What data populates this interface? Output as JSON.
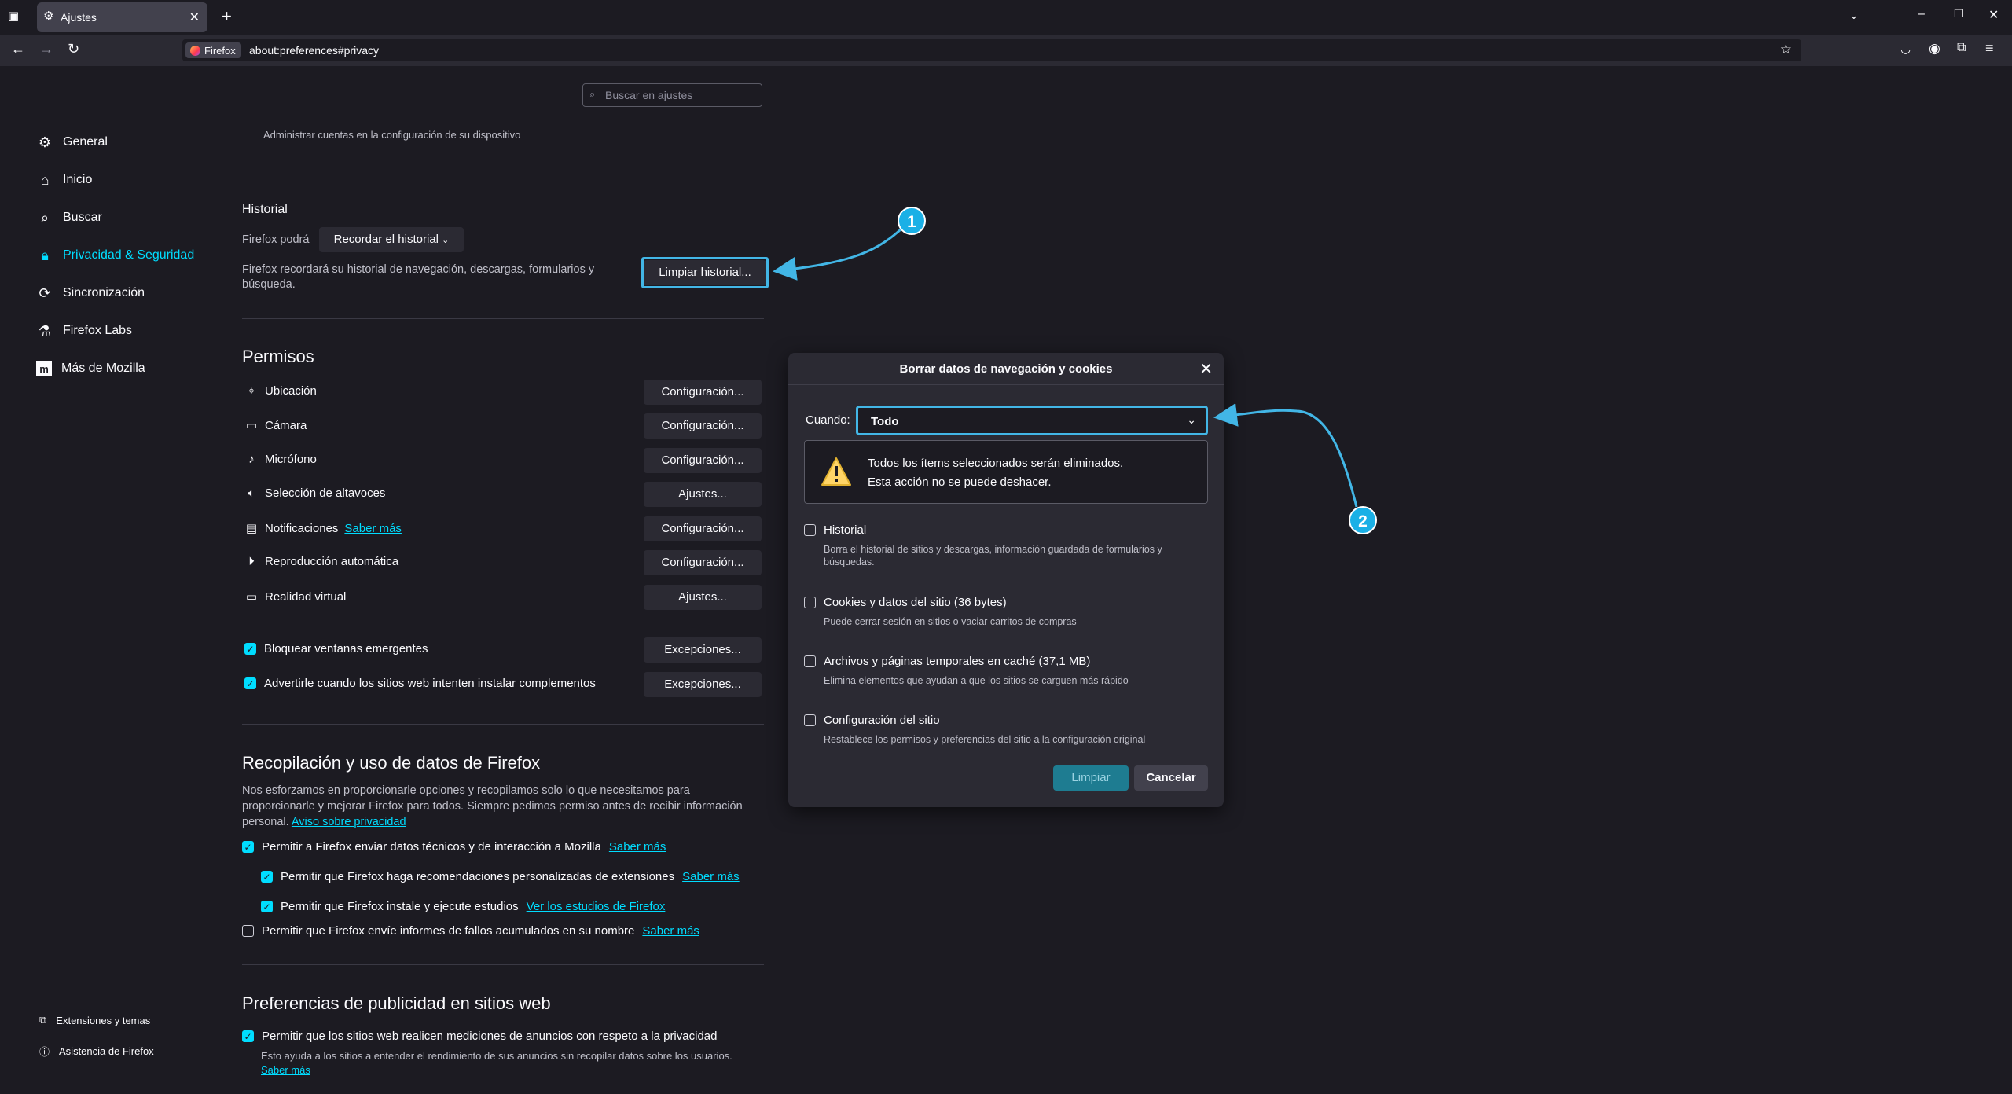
{
  "browser": {
    "tab_title": "Ajustes",
    "url_chip": "Firefox",
    "url": "about:preferences#privacy",
    "new_tab": "+",
    "tab_close": "✕"
  },
  "search": {
    "placeholder": "Buscar en ajustes"
  },
  "sidebar": {
    "items": [
      {
        "label": "General"
      },
      {
        "label": "Inicio"
      },
      {
        "label": "Buscar"
      },
      {
        "label": "Privacidad & Seguridad"
      },
      {
        "label": "Sincronización"
      },
      {
        "label": "Firefox Labs"
      },
      {
        "label": "Más de Mozilla"
      }
    ],
    "footer": [
      {
        "label": "Extensiones y temas"
      },
      {
        "label": "Asistencia de Firefox"
      }
    ]
  },
  "main": {
    "accounts_note": "Administrar cuentas en la configuración de su dispositivo",
    "history": {
      "title": "Historial",
      "firefox_will": "Firefox podrá",
      "mode_select": "Recordar el historial",
      "description_1": "Firefox recordará su historial de navegación, descargas, formularios y",
      "description_2": "búsqueda.",
      "clear_button": "Limpiar historial..."
    },
    "permissions": {
      "title": "Permisos",
      "rows": [
        {
          "label": "Ubicación",
          "button": "Configuración..."
        },
        {
          "label": "Cámara",
          "button": "Configuración..."
        },
        {
          "label": "Micrófono",
          "button": "Configuración..."
        },
        {
          "label": "Selección de altavoces",
          "button": "Ajustes..."
        },
        {
          "label": "Notificaciones",
          "link": "Saber más",
          "button": "Configuración..."
        },
        {
          "label": "Reproducción automática",
          "button": "Configuración..."
        },
        {
          "label": "Realidad virtual",
          "button": "Ajustes..."
        }
      ],
      "block_popups": "Bloquear ventanas emergentes",
      "warn_addons": "Advertirle cuando los sitios web intenten instalar complementos",
      "exceptions": "Excepciones..."
    },
    "data_collection": {
      "title": "Recopilación y uso de datos de Firefox",
      "text_1": "Nos esforzamos en proporcionarle opciones y recopilamos solo lo que necesitamos para",
      "text_2": "proporcionarle y mejorar Firefox para todos. Siempre pedimos permiso antes de recibir información",
      "text_3": "personal.",
      "privacy_link": "Aviso sobre privacidad",
      "opt1": "Permitir a Firefox enviar datos técnicos y de interacción a Mozilla",
      "opt2": "Permitir que Firefox haga recomendaciones personalizadas de extensiones",
      "opt3": "Permitir que Firefox instale y ejecute estudios",
      "opt3_link": "Ver los estudios de Firefox",
      "opt4": "Permitir que Firefox envíe informes de fallos acumulados en su nombre",
      "learn_more": "Saber más"
    },
    "ads": {
      "title": "Preferencias de publicidad en sitios web",
      "opt1": "Permitir que los sitios web realicen mediciones de anuncios con respeto a la privacidad",
      "desc": "Esto ayuda a los sitios a entender el rendimiento de sus anuncios sin recopilar datos sobre los usuarios.",
      "learn_more": "Saber más"
    }
  },
  "dialog": {
    "title": "Borrar datos de navegación y cookies",
    "when_label": "Cuando:",
    "when_value": "Todo",
    "warning_1": "Todos los ítems seleccionados serán eliminados.",
    "warning_2": "Esta acción no se puede deshacer.",
    "items": [
      {
        "title": "Historial",
        "desc_1": "Borra el historial de sitios y descargas, información guardada de formularios y",
        "desc_2": "búsquedas."
      },
      {
        "title": "Cookies y datos del sitio (36 bytes)",
        "desc_1": "Puede cerrar sesión en sitios o vaciar carritos de compras"
      },
      {
        "title": "Archivos y páginas temporales en caché (37,1 MB)",
        "desc_1": "Elimina elementos que ayudan a que los sitios se carguen más rápido"
      },
      {
        "title": "Configuración del sitio",
        "desc_1": "Restablece los permisos y preferencias del sitio a la configuración original"
      }
    ],
    "clear_button": "Limpiar",
    "cancel_button": "Cancelar"
  },
  "annotations": {
    "badge_1": "1",
    "badge_2": "2"
  },
  "colors": {
    "accent": "#00ddff",
    "annotation": "#42b6e6",
    "background": "#1c1b22"
  }
}
